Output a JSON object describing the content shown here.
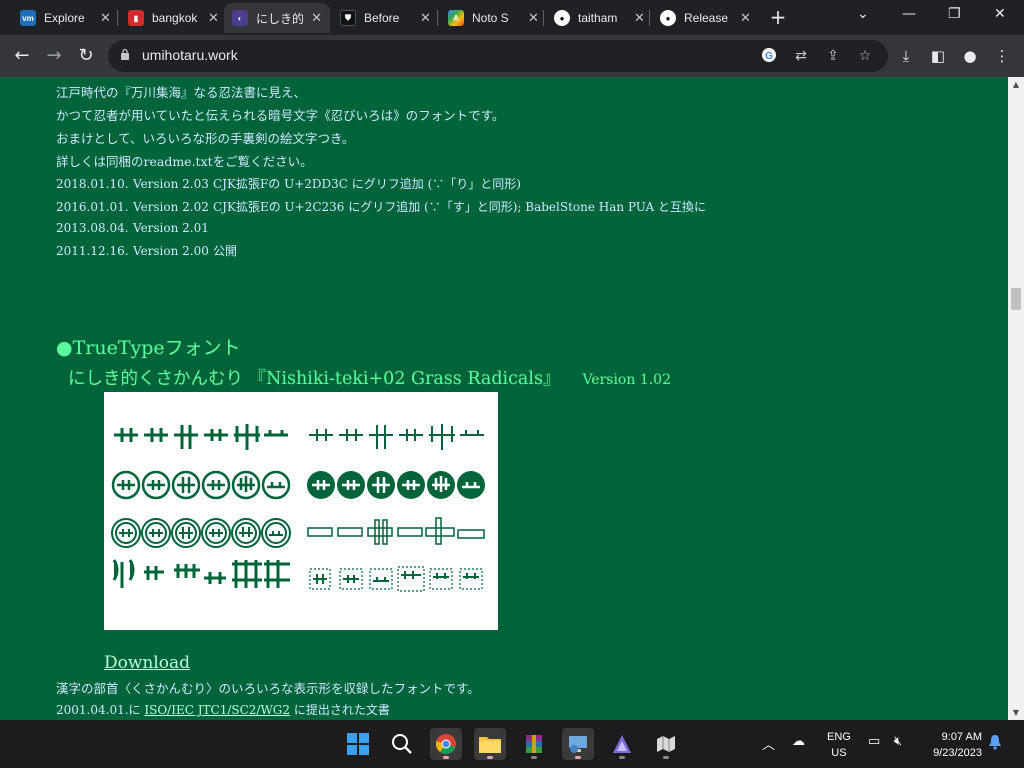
{
  "tabs": [
    {
      "title": "Explore",
      "favicon": "vmw-favicon",
      "color": "#1d6fb8"
    },
    {
      "title": "bangkok",
      "favicon": "red-favicon",
      "color": "#d12b2b"
    },
    {
      "title": "にしき的",
      "favicon": "tab-favicon",
      "color": "#4b3c8c",
      "active": true
    },
    {
      "title": "Before",
      "favicon": "shield-favicon",
      "color": "#111111"
    },
    {
      "title": "Noto S",
      "favicon": "google-fonts-favicon",
      "color": "#4285f4"
    },
    {
      "title": "taitham",
      "favicon": "github-icon",
      "color": "#ffffff"
    },
    {
      "title": "Release",
      "favicon": "github-icon",
      "color": "#ffffff"
    }
  ],
  "address": {
    "url": "umihotaru.work"
  },
  "page": {
    "intro": [
      "江戸時代の『万川集海』なる忍法書に見え、",
      "かつて忍者が用いていたと伝えられる暗号文字《忍びいろは》のフォントです。",
      "おまけとして、いろいろな形の手裏剣の絵文字つき。",
      "詳しくは同梱のreadme.txtをご覧ください。"
    ],
    "history": [
      {
        "date": "2018.01.10.",
        "version": "Version 2.03",
        "note": "CJK拡張Fの U+2DD3C にグリフ追加 (∵「り」と同形)"
      },
      {
        "date": "2016.01.01.",
        "version": "Version 2.02",
        "note": "CJK拡張Eの U+2C236 にグリフ追加 (∵「す」と同形); BabelStone Han PUA と互換に"
      },
      {
        "date": "2013.08.04.",
        "version": "Version 2.01",
        "note": ""
      },
      {
        "date": "2011.12.16.",
        "version": "Version 2.00",
        "note": "公開"
      }
    ],
    "section_heading": "●TrueTypeフォント",
    "font_title": "にしき的くさかんむり 『Nishiki-teki+02 Grass Radicals』",
    "font_version": "Version 1.02",
    "download_label": "Download",
    "description": "漢字の部首〈くさかんむり〉のいろいろな表示形を収録したフォントです。",
    "submission_date": "2001.04.01.",
    "submission_pre": "に",
    "submission_link": "ISO/IEC JTC1/SC2/WG2",
    "submission_post": "に提出された文書",
    "preview_color": "#00643a"
  },
  "taskbar": {
    "lang_line1": "ENG",
    "lang_line2": "US",
    "time": "9:07 AM",
    "date": "9/23/2023"
  }
}
